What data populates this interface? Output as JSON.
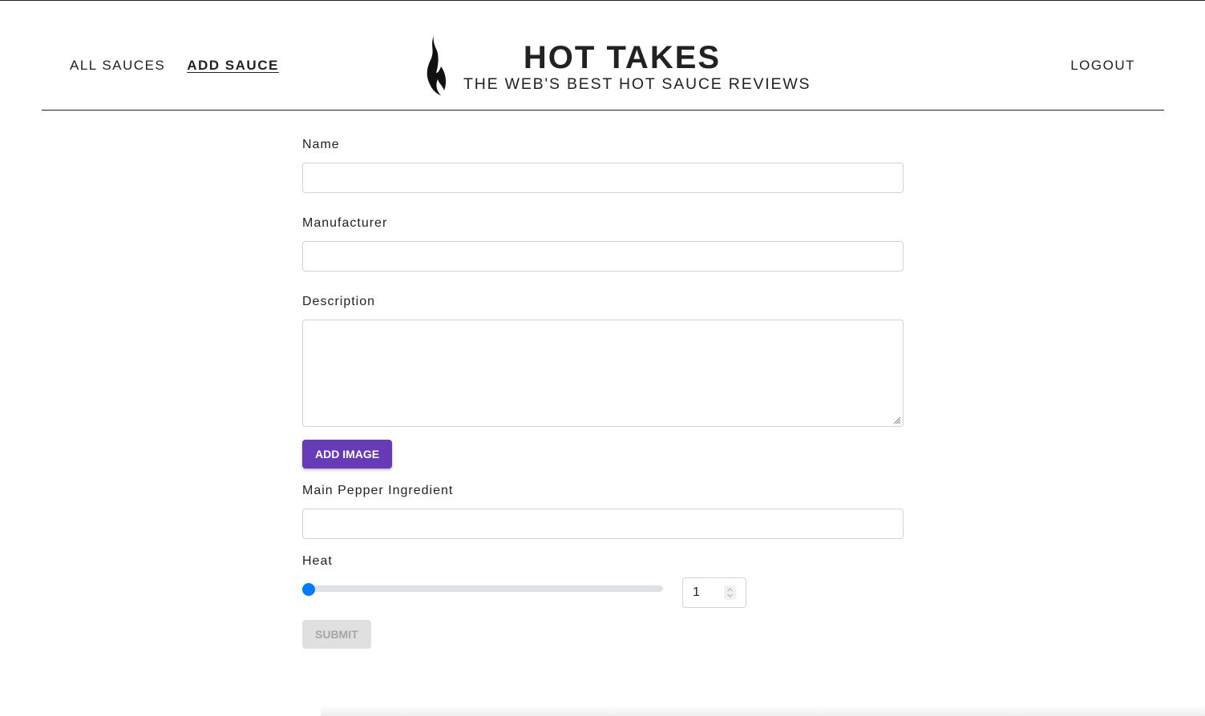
{
  "header": {
    "nav_left": [
      {
        "label": "ALL SAUCES",
        "active": false
      },
      {
        "label": "ADD SAUCE",
        "active": true
      }
    ],
    "title": "HOT TAKES",
    "subtitle": "THE WEB'S BEST HOT SAUCE REVIEWS",
    "logo_icon": "flame-icon",
    "logout_label": "LOGOUT"
  },
  "form": {
    "name": {
      "label": "Name",
      "value": ""
    },
    "manufacturer": {
      "label": "Manufacturer",
      "value": ""
    },
    "description": {
      "label": "Description",
      "value": ""
    },
    "add_image_label": "ADD IMAGE",
    "main_pepper": {
      "label": "Main Pepper Ingredient",
      "value": ""
    },
    "heat": {
      "label": "Heat",
      "value": "1",
      "min": 1,
      "max": 10
    },
    "submit_label": "SUBMIT",
    "submit_disabled": true
  },
  "colors": {
    "primary_button": "#673ab7",
    "slider_accent": "#007bff",
    "disabled_button": "#e0e0e0"
  }
}
